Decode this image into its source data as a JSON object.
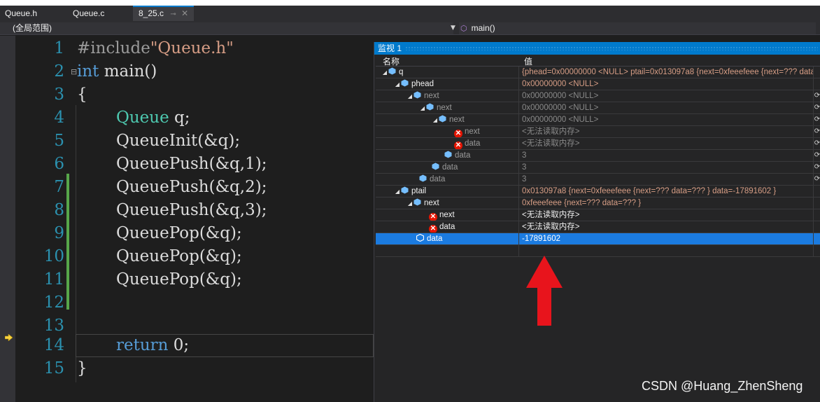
{
  "tabs": [
    {
      "label": "Queue.h"
    },
    {
      "label": "Queue.c"
    },
    {
      "label": "8_25.c",
      "active": true,
      "pin": "⊸",
      "close": "✕"
    }
  ],
  "navbar": {
    "scope": "(全局范围)",
    "function": "main()"
  },
  "editor": {
    "lines": [
      {
        "num": "1",
        "code": "#include\"Queue.h\""
      },
      {
        "num": "2",
        "code": "int main()"
      },
      {
        "num": "3",
        "code": "{"
      },
      {
        "num": "4",
        "code": "Queue q;"
      },
      {
        "num": "5",
        "code": "QueueInit(&q);"
      },
      {
        "num": "6",
        "code": "QueuePush(&q,1);"
      },
      {
        "num": "7",
        "code": "QueuePush(&q,2);"
      },
      {
        "num": "8",
        "code": "QueuePush(&q,3);"
      },
      {
        "num": "9",
        "code": "QueuePop(&q);"
      },
      {
        "num": "10",
        "code": "QueuePop(&q);"
      },
      {
        "num": "11",
        "code": "QueuePop(&q);"
      },
      {
        "num": "12",
        "code": ""
      },
      {
        "num": "13",
        "code": ""
      },
      {
        "num": "14",
        "code": "return 0;"
      },
      {
        "num": "15",
        "code": "}"
      }
    ],
    "include_kw": "#include",
    "include_str": "\"Queue.h\"",
    "int_kw": "int",
    "main_rest": " main()",
    "queue_type": "Queue",
    "q_decl": " q;",
    "return_kw": "return",
    "return_rest": " 0;"
  },
  "watch": {
    "title": "监视 1",
    "col_name": "名称",
    "col_value": "值",
    "rows": [
      {
        "name": "q",
        "value": "{phead=0x00000000 <NULL> ptail=0x013097a8 {next=0xfeeefeee {next=??? data"
      },
      {
        "name": "phead",
        "value": "0x00000000 <NULL>"
      },
      {
        "name": "next",
        "value": "0x00000000 <NULL>"
      },
      {
        "name": "next",
        "value": "0x00000000 <NULL>"
      },
      {
        "name": "next",
        "value": "0x00000000 <NULL>"
      },
      {
        "name": "next",
        "value": "<无法读取内存>"
      },
      {
        "name": "data",
        "value": "<无法读取内存>"
      },
      {
        "name": "data",
        "value": "3"
      },
      {
        "name": "data",
        "value": "3"
      },
      {
        "name": "data",
        "value": "3"
      },
      {
        "name": "ptail",
        "value": "0x013097a8 {next=0xfeeefeee {next=??? data=??? } data=-17891602 }"
      },
      {
        "name": "next",
        "value": "0xfeeefeee {next=??? data=??? }"
      },
      {
        "name": "next",
        "value": "<无法读取内存>"
      },
      {
        "name": "data",
        "value": "<无法读取内存>"
      },
      {
        "name": "data",
        "value": "-17891602"
      },
      {
        "name": "",
        "value": ""
      }
    ]
  },
  "watermark": "CSDN @Huang_ZhenSheng",
  "colors": {
    "accent": "#007acc",
    "selected_row": "#1b7be0",
    "arrow": "#e8141c",
    "change_bar": "#57a64a"
  }
}
